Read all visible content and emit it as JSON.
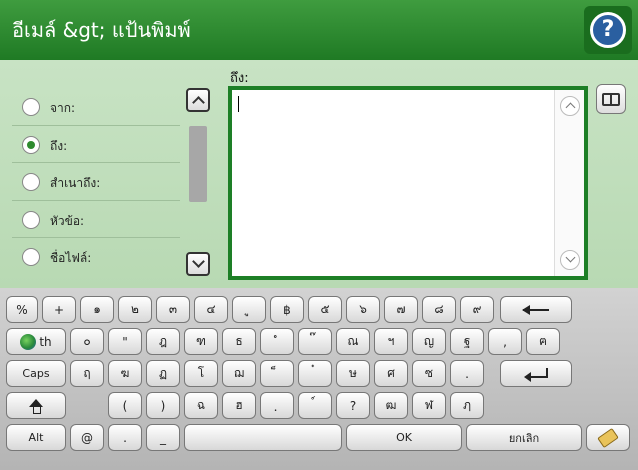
{
  "header": {
    "title": "อีเมล์ &gt; แป้นพิมพ์",
    "help_symbol": "?"
  },
  "form": {
    "to_label": "ถึง:",
    "to_value": "",
    "fields": [
      {
        "label": "จาก:",
        "selected": false
      },
      {
        "label": "ถึง:",
        "selected": true
      },
      {
        "label": "สำเนาถึง:",
        "selected": false
      },
      {
        "label": "หัวข้อ:",
        "selected": false
      },
      {
        "label": "ชื่อไฟล์:",
        "selected": false
      }
    ]
  },
  "keyboard": {
    "row1": [
      "%",
      "+",
      "๑",
      "๒",
      "๓",
      "๔",
      "ู",
      "฿",
      "๕",
      "๖",
      "๗",
      "๘",
      "๙"
    ],
    "row2": [
      "th",
      "๐",
      "\"",
      "ฎ",
      "ฑ",
      "ธ",
      "ํ",
      "๊",
      "ณ",
      "ฯ",
      "ญ",
      "ฐ",
      ",",
      "ฅ"
    ],
    "row3": [
      "Caps",
      "ฤ",
      "ฆ",
      "ฏ",
      "โ",
      "ฌ",
      "็",
      "๋",
      "ษ",
      "ศ",
      "ซ",
      "."
    ],
    "row4": [
      "(",
      ")",
      "ฉ",
      "ฮ",
      "ฺ",
      "์",
      "?",
      "ฒ",
      "ฬ",
      "ฦ"
    ],
    "row5": [
      "Alt",
      "@",
      ".",
      "_",
      "",
      "OK",
      "ยกเลิก"
    ],
    "icons": {
      "backspace": "backspace-icon",
      "enter": "enter-icon",
      "shift": "shift-icon",
      "language": "globe-icon",
      "clear": "eraser-icon"
    }
  }
}
